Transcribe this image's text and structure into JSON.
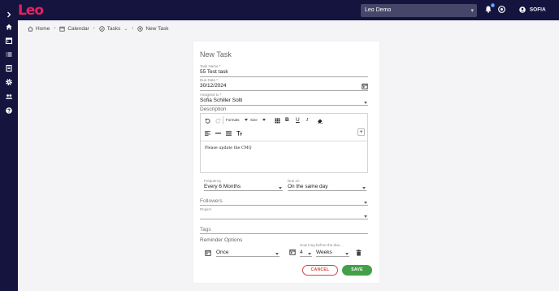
{
  "topbar": {
    "logo": "Leo",
    "company_select": "Leo Demo",
    "notification_count": "8",
    "user_name": "SOFIA"
  },
  "sidenav": {
    "icons": [
      "chevron-right-icon",
      "home-icon",
      "calendar-icon",
      "list-icon",
      "book-icon",
      "gear-icon",
      "users-icon",
      "help-icon"
    ]
  },
  "breadcrumb": {
    "home": "Home",
    "calendar": "Calendar",
    "tasks": "Tasks",
    "new_task": "New Task"
  },
  "form": {
    "title": "New Task",
    "task_name_label": "Task Name *",
    "task_name_value": "55 Test task",
    "due_date_label": "Due Date *",
    "due_date_value": "30/12/2024",
    "assigned_to_label": "Assigned to *",
    "assigned_to_value": "Sofia Schiller Solti",
    "description_label": "Description",
    "description_text": "Please update the CMQ",
    "toolbar": {
      "formats": "Formats",
      "size": "Size"
    },
    "frequency_label": "Frequency",
    "frequency_value": "Every 6 Months",
    "due_on_label": "Due on",
    "due_on_value": "On the same day",
    "followers_placeholder": "Followers",
    "project_label": "Project",
    "tags_placeholder": "Tags",
    "reminder_options_label": "Reminder Options",
    "reminder_frequency_value": "Once",
    "how_long_label": "How long before the due...",
    "reminder_amount_value": "4",
    "reminder_unit_value": "Weeks",
    "cancel_label": "CANCEL",
    "save_label": "SAVE"
  },
  "colors": {
    "nav_bg": "#14143f",
    "brand": "#e0245e",
    "save": "#43a047",
    "cancel": "#d54545"
  }
}
